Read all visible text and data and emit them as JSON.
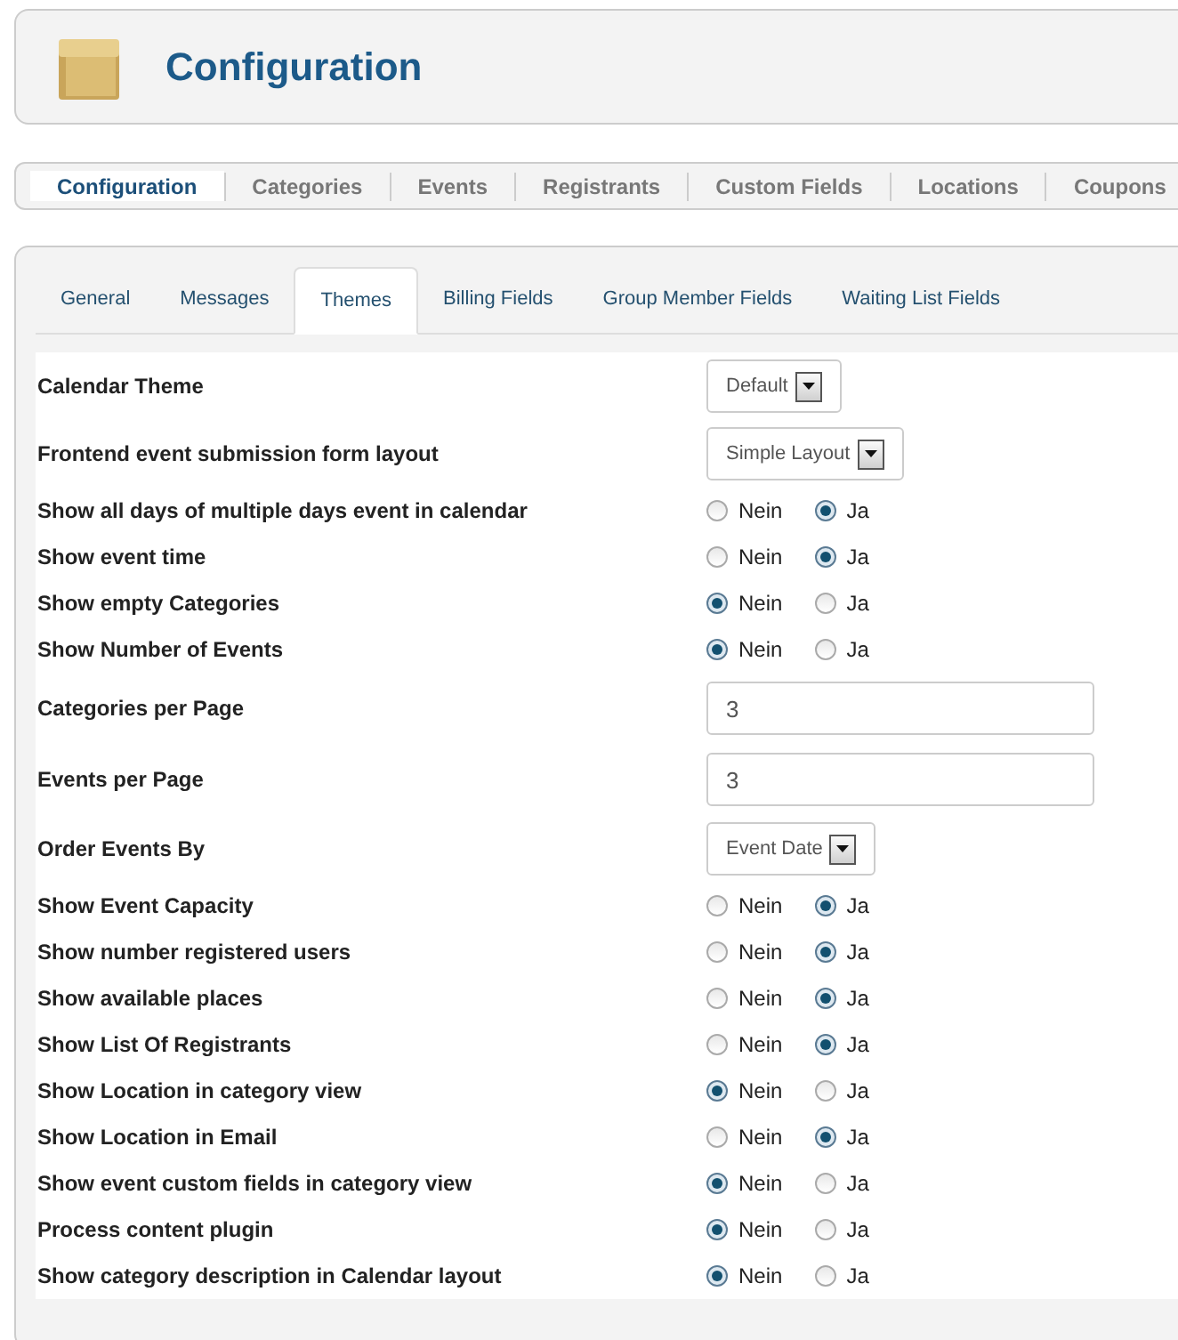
{
  "header": {
    "title": "Configuration"
  },
  "main_menu": [
    {
      "label": "Configuration",
      "selected": true
    },
    {
      "label": "Categories",
      "selected": false
    },
    {
      "label": "Events",
      "selected": false
    },
    {
      "label": "Registrants",
      "selected": false
    },
    {
      "label": "Custom Fields",
      "selected": false
    },
    {
      "label": "Locations",
      "selected": false
    },
    {
      "label": "Coupons",
      "selected": false
    }
  ],
  "tabs": [
    {
      "label": "General",
      "selected": false
    },
    {
      "label": "Messages",
      "selected": false
    },
    {
      "label": "Themes",
      "selected": true
    },
    {
      "label": "Billing Fields",
      "selected": false
    },
    {
      "label": "Group Member Fields",
      "selected": false
    },
    {
      "label": "Waiting List Fields",
      "selected": false
    }
  ],
  "settings": [
    {
      "kind": "select",
      "label": "Calendar Theme",
      "value": "Default"
    },
    {
      "kind": "select",
      "label": "Frontend event submission form layout",
      "value": "Simple Layout"
    },
    {
      "kind": "radio",
      "label": "Show all days of multiple days event in calendar",
      "options": [
        {
          "label": "Nein",
          "selected": false
        },
        {
          "label": "Ja",
          "selected": true
        }
      ]
    },
    {
      "kind": "radio",
      "label": "Show event time",
      "options": [
        {
          "label": "Nein",
          "selected": false
        },
        {
          "label": "Ja",
          "selected": true
        }
      ]
    },
    {
      "kind": "radio",
      "label": "Show empty Categories",
      "options": [
        {
          "label": "Nein",
          "selected": true
        },
        {
          "label": "Ja",
          "selected": false
        }
      ]
    },
    {
      "kind": "radio",
      "label": "Show Number of Events",
      "options": [
        {
          "label": "Nein",
          "selected": true
        },
        {
          "label": "Ja",
          "selected": false
        }
      ]
    },
    {
      "kind": "text",
      "label": "Categories per Page",
      "value": "3"
    },
    {
      "kind": "text",
      "label": "Events per Page",
      "value": "3"
    },
    {
      "kind": "select",
      "label": "Order Events By",
      "value": "Event Date"
    },
    {
      "kind": "radio",
      "label": "Show Event Capacity",
      "options": [
        {
          "label": "Nein",
          "selected": false
        },
        {
          "label": "Ja",
          "selected": true
        }
      ]
    },
    {
      "kind": "radio",
      "label": "Show number registered users",
      "options": [
        {
          "label": "Nein",
          "selected": false
        },
        {
          "label": "Ja",
          "selected": true
        }
      ]
    },
    {
      "kind": "radio",
      "label": "Show available places",
      "options": [
        {
          "label": "Nein",
          "selected": false
        },
        {
          "label": "Ja",
          "selected": true
        }
      ]
    },
    {
      "kind": "radio",
      "label": "Show List Of Registrants",
      "options": [
        {
          "label": "Nein",
          "selected": false
        },
        {
          "label": "Ja",
          "selected": true
        }
      ]
    },
    {
      "kind": "radio",
      "label": "Show Location in category view",
      "options": [
        {
          "label": "Nein",
          "selected": true
        },
        {
          "label": "Ja",
          "selected": false
        }
      ]
    },
    {
      "kind": "radio",
      "label": "Show Location in Email",
      "options": [
        {
          "label": "Nein",
          "selected": false
        },
        {
          "label": "Ja",
          "selected": true
        }
      ]
    },
    {
      "kind": "radio",
      "label": "Show event custom fields in category view",
      "options": [
        {
          "label": "Nein",
          "selected": true
        },
        {
          "label": "Ja",
          "selected": false
        }
      ]
    },
    {
      "kind": "radio",
      "label": "Process content plugin",
      "options": [
        {
          "label": "Nein",
          "selected": true
        },
        {
          "label": "Ja",
          "selected": false
        }
      ]
    },
    {
      "kind": "radio",
      "label": "Show category description in Calendar layout",
      "options": [
        {
          "label": "Nein",
          "selected": true
        },
        {
          "label": "Ja",
          "selected": false
        }
      ]
    }
  ]
}
